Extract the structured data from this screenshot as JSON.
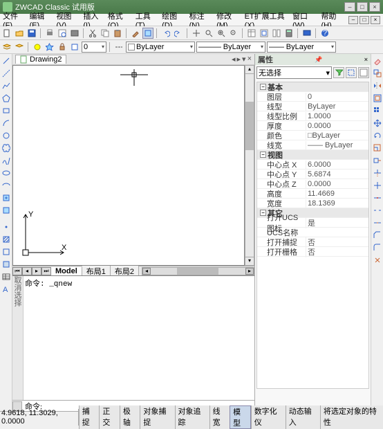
{
  "title": "ZWCAD Classic 试用版",
  "menus": [
    "文件(F)",
    "编辑(E)",
    "视图(V)",
    "插入(I)",
    "格式(O)",
    "工具(T)",
    "绘图(D)",
    "标注(N)",
    "修改(M)",
    "ET扩展工具(X)",
    "窗口(W)",
    "帮助(H)"
  ],
  "doc_tab": "Drawing2",
  "layer_combo": "ByLayer",
  "lineweight_combo": "ByLayer",
  "model_tabs": {
    "model": "Model",
    "layout1": "布局1",
    "layout2": "布局2"
  },
  "cmd_history_side": "取消选择",
  "cmd_history": "命令: _qnew",
  "cmd_prompt": "命令:",
  "coords": "4.9618, 11.3029, 0.0000",
  "status_toggles": [
    "捕捉",
    "正交",
    "极轴",
    "对象捕捉",
    "对象追踪",
    "线宽",
    "模型",
    "数字化仪",
    "动态输入",
    "将选定对象的特性"
  ],
  "status_on": [
    6
  ],
  "properties": {
    "title": "属性",
    "selection": "无选择",
    "rows": [
      {
        "cat": "基本"
      },
      {
        "k": "图层",
        "v": "0"
      },
      {
        "k": "线型",
        "v": "ByLayer"
      },
      {
        "k": "线型比例",
        "v": "1.0000"
      },
      {
        "k": "厚度",
        "v": "0.0000"
      },
      {
        "k": "颜色",
        "v": "□ByLayer"
      },
      {
        "k": "线宽",
        "v": "—— ByLayer"
      },
      {
        "cat": "视图"
      },
      {
        "k": "中心点 X",
        "v": "6.0000"
      },
      {
        "k": "中心点 Y",
        "v": "5.6874"
      },
      {
        "k": "中心点 Z",
        "v": "0.0000"
      },
      {
        "k": "高度",
        "v": "11.4669"
      },
      {
        "k": "宽度",
        "v": "18.1369"
      },
      {
        "cat": "其它"
      },
      {
        "k": "打开UCS图标",
        "v": "是"
      },
      {
        "k": "UCS名称",
        "v": ""
      },
      {
        "k": "打开捕捉",
        "v": "否"
      },
      {
        "k": "打开栅格",
        "v": "否"
      }
    ]
  },
  "ucs": {
    "x_label": "X",
    "y_label": "Y"
  }
}
